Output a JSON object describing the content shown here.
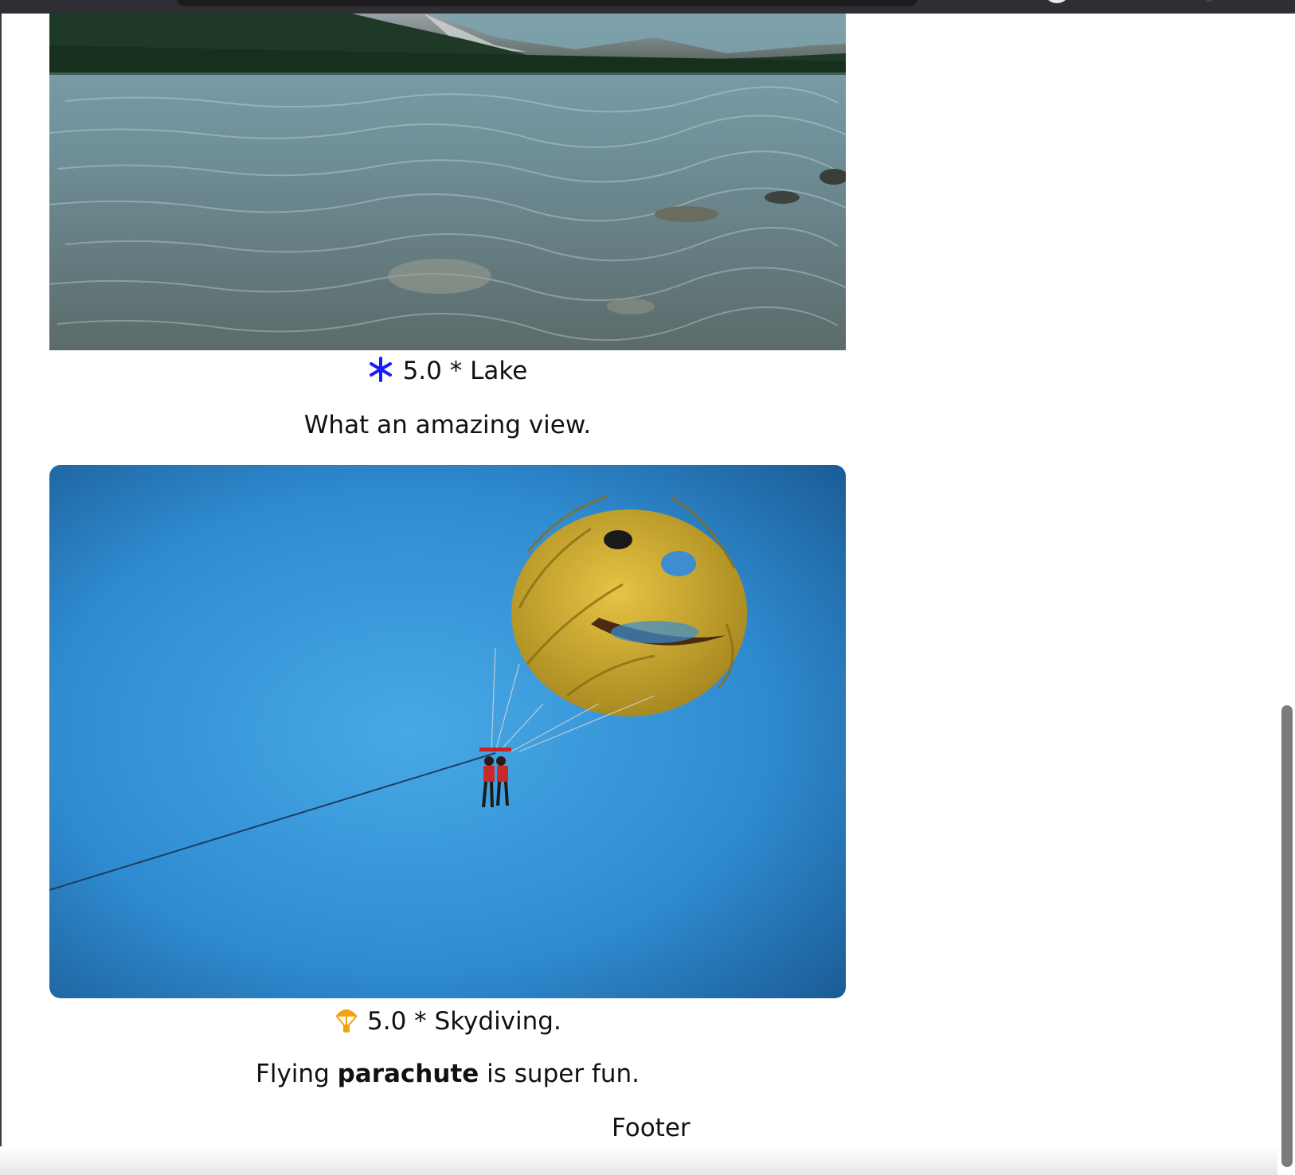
{
  "cards": [
    {
      "photo": "lake-photo",
      "rating": "5.0 * Lake",
      "icon": "snowflake-icon",
      "icon_color": "#1a1aff",
      "description": "What an amazing view."
    },
    {
      "photo": "parachute-photo",
      "rating": "5.0 * Skydiving.",
      "icon": "parachute-icon",
      "icon_color": "#f0a30a",
      "description_before": "Flying ",
      "description_bold": "parachute",
      "description_after": " is super fun."
    }
  ],
  "footer": "Footer"
}
